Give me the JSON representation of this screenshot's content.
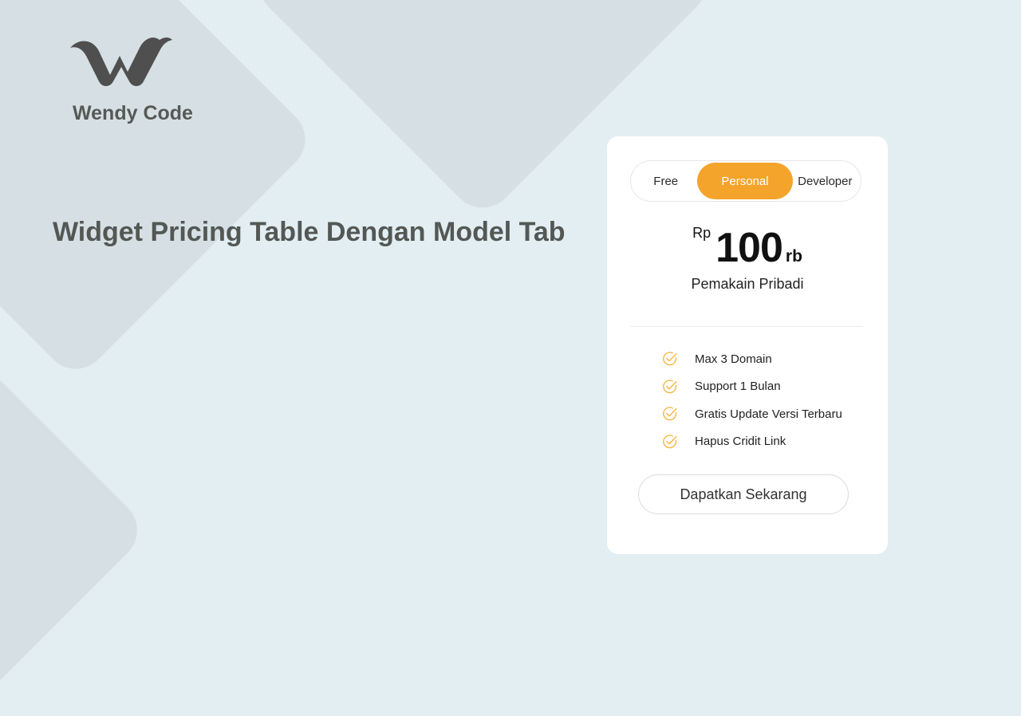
{
  "brand": {
    "name": "Wendy Code",
    "logo_icon": "wendy-code-w-logo-icon"
  },
  "headline": "Widget Pricing Table Dengan Model Tab",
  "pricing": {
    "tabs": [
      {
        "label": "Free",
        "active": false
      },
      {
        "label": "Personal",
        "active": true
      },
      {
        "label": "Developer",
        "active": false
      }
    ],
    "currency": "Rp",
    "amount": "100",
    "unit": "rb",
    "plan_description": "Pemakain Pribadi",
    "features": [
      "Max 3 Domain",
      "Support 1 Bulan",
      "Gratis Update Versi Terbaru",
      "Hapus Cridit Link"
    ],
    "feature_icon": "check-circle-icon",
    "cta_label": "Dapatkan Sekarang"
  },
  "colors": {
    "accent": "#f5a42b",
    "background": "#e3eef2",
    "text_dark": "#545855"
  }
}
